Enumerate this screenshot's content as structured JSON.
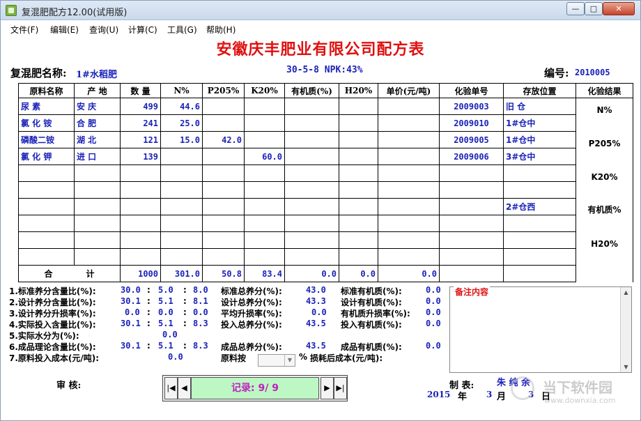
{
  "window": {
    "title": "复混肥配方12.00(试用版)",
    "min": "—",
    "max": "□",
    "close": "✕"
  },
  "menu": [
    "文件(F)",
    "编辑(E)",
    "查询(U)",
    "计算(C)",
    "工具(G)",
    "帮助(H)"
  ],
  "company": "安徽庆丰肥业有限公司配方表",
  "header": {
    "name_label": "复混肥名称:",
    "name_value": "1#水稻肥",
    "formula": "30-5-8 NPK:43%",
    "code_label": "编号:",
    "code_value": "2010005"
  },
  "table": {
    "columns": [
      "原料名称",
      "产  地",
      "数  量",
      "N%",
      "P205%",
      "K20%",
      "有机质(%)",
      "H20%",
      "单价(元/吨)",
      "化验单号",
      "存放位置",
      "化验结果"
    ],
    "rows": [
      {
        "name": "尿   素",
        "origin": "安  庆",
        "qty": "499",
        "n": "44.6",
        "p": "",
        "k": "",
        "org": "",
        "h2o": "",
        "price": "",
        "lab": "2009003",
        "loc": "旧  仓"
      },
      {
        "name": "氯 化 铵",
        "origin": "合  肥",
        "qty": "241",
        "n": "25.0",
        "p": "",
        "k": "",
        "org": "",
        "h2o": "",
        "price": "",
        "lab": "2009010",
        "loc": "1#仓中"
      },
      {
        "name": "磷酸二铵",
        "origin": "湖  北",
        "qty": "121",
        "n": "15.0",
        "p": "42.0",
        "k": "",
        "org": "",
        "h2o": "",
        "price": "",
        "lab": "2009005",
        "loc": "1#仓中"
      },
      {
        "name": "氯 化 钾",
        "origin": "进  口",
        "qty": "139",
        "n": "",
        "p": "",
        "k": "60.0",
        "org": "",
        "h2o": "",
        "price": "",
        "lab": "2009006",
        "loc": "3#仓中"
      },
      {
        "name": "",
        "origin": "",
        "qty": "",
        "n": "",
        "p": "",
        "k": "",
        "org": "",
        "h2o": "",
        "price": "",
        "lab": "",
        "loc": ""
      },
      {
        "name": "",
        "origin": "",
        "qty": "",
        "n": "",
        "p": "",
        "k": "",
        "org": "",
        "h2o": "",
        "price": "",
        "lab": "",
        "loc": ""
      },
      {
        "name": "",
        "origin": "",
        "qty": "",
        "n": "",
        "p": "",
        "k": "",
        "org": "",
        "h2o": "",
        "price": "",
        "lab": "",
        "loc": "2#仓西"
      },
      {
        "name": "",
        "origin": "",
        "qty": "",
        "n": "",
        "p": "",
        "k": "",
        "org": "",
        "h2o": "",
        "price": "",
        "lab": "",
        "loc": ""
      },
      {
        "name": "",
        "origin": "",
        "qty": "",
        "n": "",
        "p": "",
        "k": "",
        "org": "",
        "h2o": "",
        "price": "",
        "lab": "",
        "loc": ""
      },
      {
        "name": "",
        "origin": "",
        "qty": "",
        "n": "",
        "p": "",
        "k": "",
        "org": "",
        "h2o": "",
        "price": "",
        "lab": "",
        "loc": ""
      }
    ],
    "results": [
      "N%",
      "P205%",
      "K20%",
      "有机质%",
      "H20%"
    ],
    "total": {
      "label1": "合",
      "label2": "计",
      "qty": "1000",
      "n": "301.0",
      "p": "50.8",
      "k": "83.4",
      "org": "0.0",
      "h2o": "0.0",
      "price": "0.0"
    }
  },
  "stats": {
    "r1": {
      "label": "1.标准养分含量比(%):",
      "a": "30.0",
      "b": "5.0",
      "c": "8.0",
      "l2": "标准总养分(%):",
      "v2": "43.0",
      "l3": "标准有机质(%):",
      "v3": "0.0"
    },
    "r2": {
      "label": "2.设计养分含量比(%):",
      "a": "30.1",
      "b": "5.1",
      "c": "8.1",
      "l2": "设计总养分(%):",
      "v2": "43.3",
      "l3": "设计有机质(%):",
      "v3": "0.0"
    },
    "r3": {
      "label": "3.设计养分升损率(%):",
      "a": "0.0",
      "b": "0.0",
      "c": "0.0",
      "l2": "平均升损率(%):",
      "v2": "0.0",
      "l3": "有机质升损率(%):",
      "v3": "0.0"
    },
    "r4": {
      "label": "4.实际投入含量比(%):",
      "a": "30.1",
      "b": "5.1",
      "c": "8.3",
      "l2": "投入总养分(%):",
      "v2": "43.5",
      "l3": "投入有机质(%):",
      "v3": "0.0"
    },
    "r5": {
      "label": "5.实际水分为(%):",
      "a": "0.0"
    },
    "r6": {
      "label": "6.成品理论含量比(%):",
      "a": "30.1",
      "b": "5.1",
      "c": "8.3",
      "l2": "成品总养分(%):",
      "v2": "43.5",
      "l3": "成品有机质(%):",
      "v3": "0.0"
    },
    "r7": {
      "label": "7.原料投入成本(元/吨):",
      "a": "0.0",
      "l2": "原料按",
      "unit": "%",
      "l3": "损耗后成本(元/吨):"
    },
    "sep": ":"
  },
  "notes": {
    "title": "备注内容"
  },
  "nav": {
    "first": "|◀",
    "prev": "◀",
    "record": "记录:  9/ 9",
    "next": "▶",
    "last": "▶|"
  },
  "footer": {
    "audit": "审   核:",
    "maker_label": "制   表:",
    "maker": "朱 纯 余",
    "year": "2015",
    "year_lbl": "年",
    "month": "3",
    "month_lbl": "月",
    "day": "3",
    "day_lbl": "日"
  },
  "watermark": {
    "t1": "当下软件园",
    "t2": "www.downxia.com"
  }
}
